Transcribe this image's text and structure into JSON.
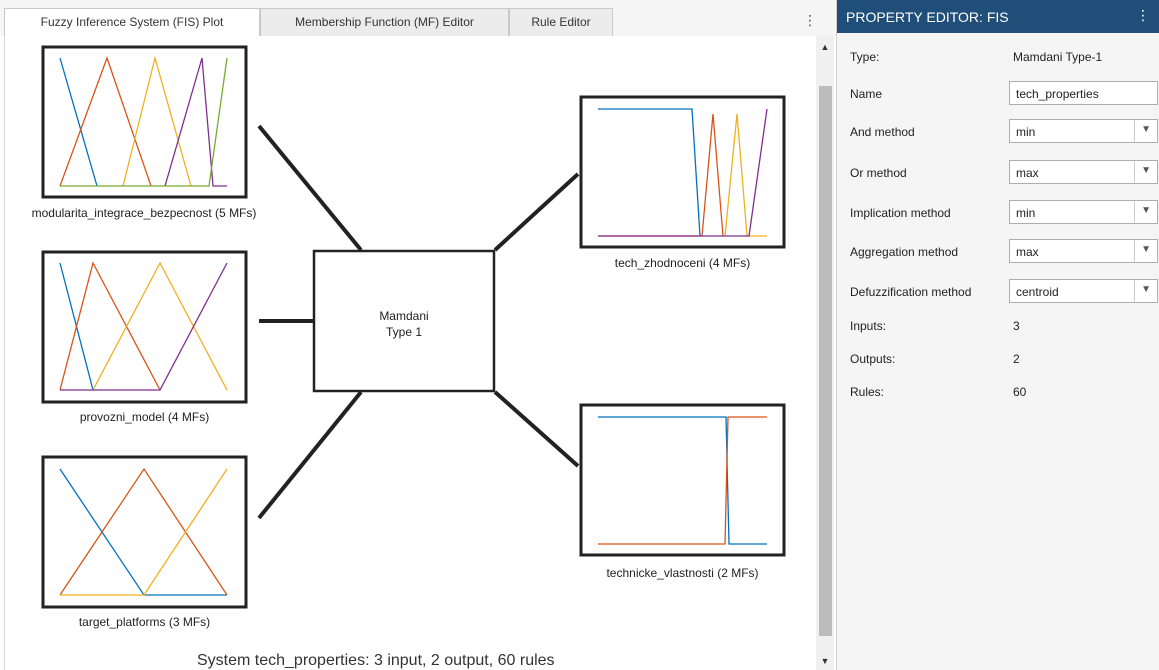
{
  "tabs": [
    {
      "label": "Fuzzy Inference System (FIS) Plot",
      "active": true
    },
    {
      "label": "Membership Function (MF) Editor",
      "active": false
    },
    {
      "label": "Rule Editor",
      "active": false
    }
  ],
  "tab_menu_icon": "vertical-ellipsis-icon",
  "fis_plot": {
    "inputs": [
      {
        "label": "modularita_integrace_bezpecnost (5 MFs)"
      },
      {
        "label": "provozni_model (4 MFs)"
      },
      {
        "label": "target_platforms (3 MFs)"
      }
    ],
    "outputs": [
      {
        "label": "tech_zhodnoceni (4 MFs)"
      },
      {
        "label": "technicke_vlastnosti (2 MFs)"
      }
    ],
    "system_box": {
      "line1": "Mamdani",
      "line2": "Type 1"
    },
    "summary": "System tech_properties: 3 input, 2 output, 60 rules",
    "mf_colors": [
      "#0072BD",
      "#D95319",
      "#EDB120",
      "#7E2F8E",
      "#77AC30"
    ]
  },
  "property_editor": {
    "title": "PROPERTY EDITOR: FIS",
    "menu_icon": "vertical-ellipsis-icon",
    "header_color": "#1f4e79",
    "rows": {
      "type": {
        "label": "Type:",
        "value": "Mamdani Type-1"
      },
      "name": {
        "label": "Name",
        "value": "tech_properties"
      },
      "and_method": {
        "label": "And method",
        "value": "min"
      },
      "or_method": {
        "label": "Or method",
        "value": "max"
      },
      "implication_method": {
        "label": "Implication method",
        "value": "min"
      },
      "aggregation_method": {
        "label": "Aggregation method",
        "value": "max"
      },
      "defuzzification_method": {
        "label": "Defuzzification method",
        "value": "centroid"
      },
      "inputs": {
        "label": "Inputs:",
        "value": "3"
      },
      "outputs": {
        "label": "Outputs:",
        "value": "2"
      },
      "rules": {
        "label": "Rules:",
        "value": "60"
      }
    }
  }
}
